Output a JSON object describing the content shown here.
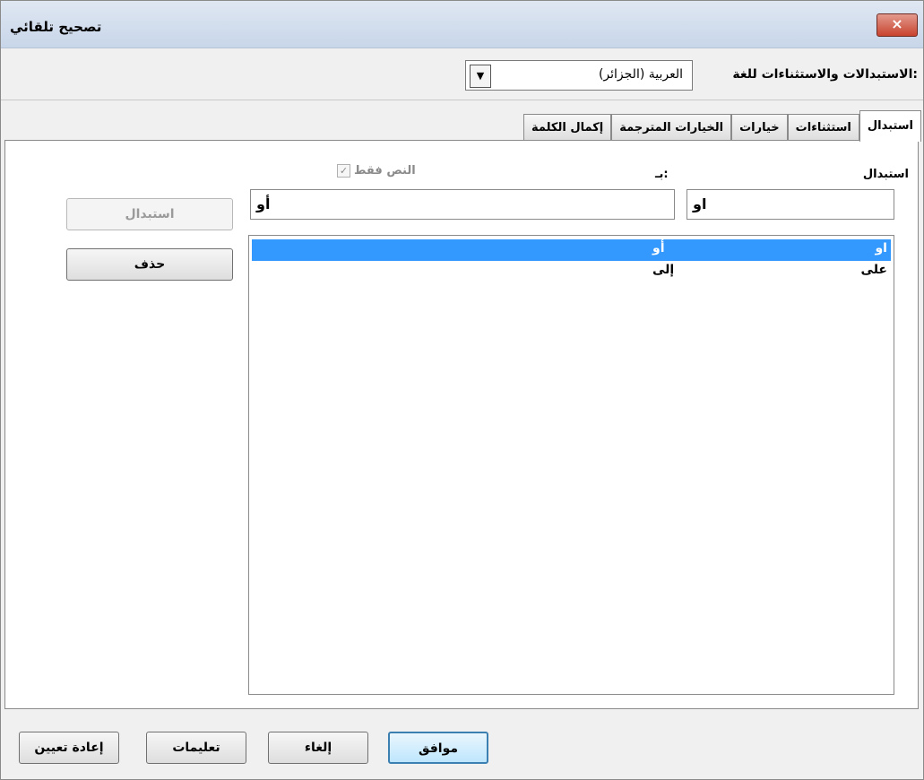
{
  "window": {
    "title": "تصحيح تلقائي",
    "close_glyph": "×"
  },
  "language": {
    "label": "الاستبدالات والاستثناءات للغة:",
    "selected": "العربية (الجزائر)",
    "arrow_glyph": "▼"
  },
  "tabs": [
    {
      "label": "استبدال",
      "active": true
    },
    {
      "label": "استثناءات",
      "active": false
    },
    {
      "label": "خيارات",
      "active": false
    },
    {
      "label": "الخيارات المترجمة",
      "active": false
    },
    {
      "label": "إكمال الكلمة",
      "active": false
    }
  ],
  "replace_tab": {
    "replace_label": "استبدال",
    "with_label": "بـ:",
    "text_only_label": "النص فقط",
    "text_only_check": "✓",
    "replace_value": "او",
    "with_value": "أو",
    "rows": [
      {
        "replace": "او",
        "with": "أو",
        "selected": true
      },
      {
        "replace": "على",
        "with": "إلى",
        "selected": false
      }
    ],
    "replace_button": "استبدال",
    "delete_button": "حذف"
  },
  "footer": {
    "ok": "موافق",
    "cancel": "إلغاء",
    "help": "تعليمات",
    "reset": "إعادة تعيين"
  }
}
